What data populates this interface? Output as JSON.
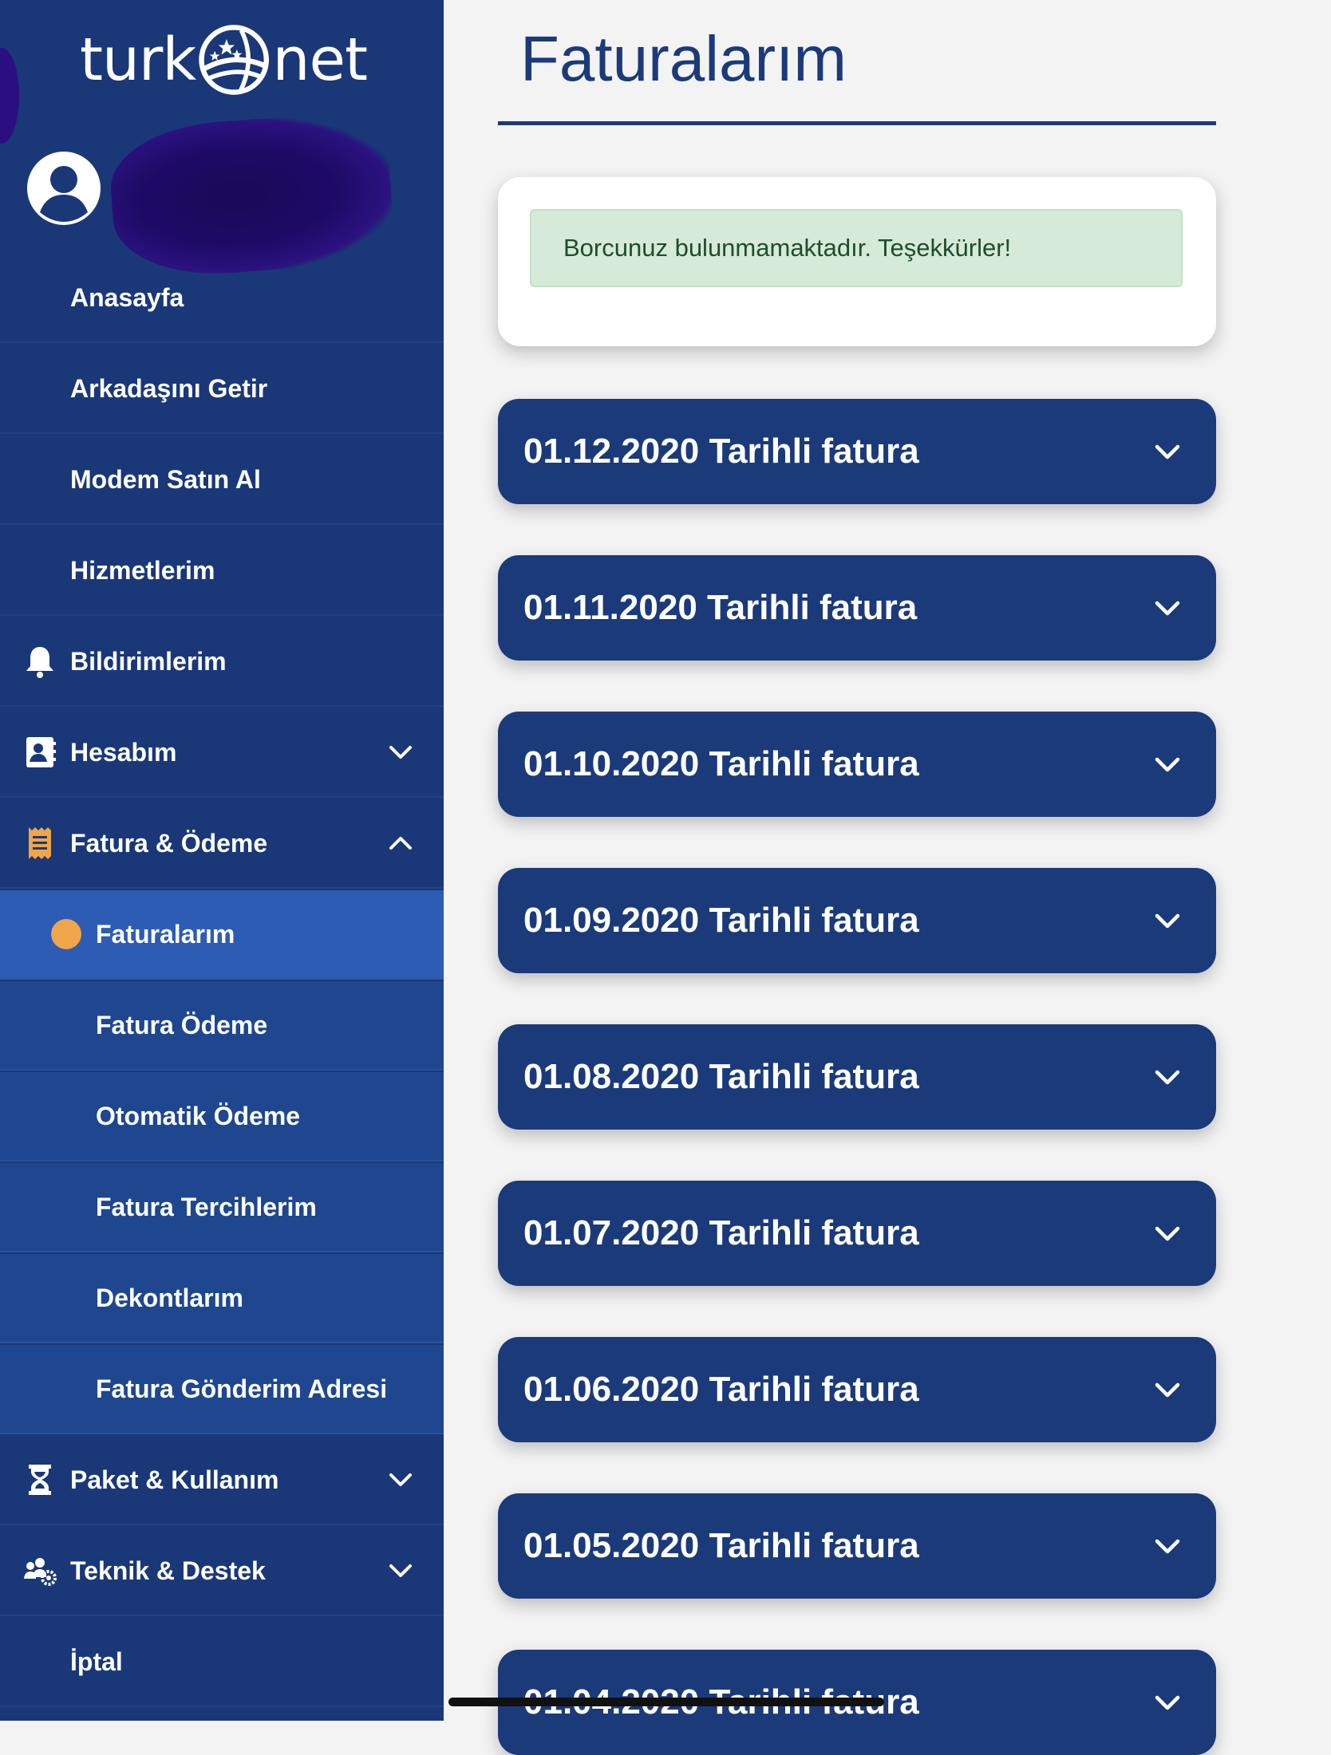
{
  "brand": {
    "logo_left": "turk",
    "logo_right": "net"
  },
  "sidebar": {
    "items": [
      {
        "label": "Anasayfa"
      },
      {
        "label": "Arkadaşını Getir"
      },
      {
        "label": "Modem Satın Al"
      },
      {
        "label": "Hizmetlerim"
      },
      {
        "label": "Bildirimlerim",
        "icon": "bell-icon"
      },
      {
        "label": "Hesabım",
        "icon": "contact-card-icon",
        "expanded": false
      },
      {
        "label": "Fatura & Ödeme",
        "icon": "receipt-icon",
        "expanded": true
      },
      {
        "label": "Paket & Kullanım",
        "icon": "hourglass-icon",
        "expanded": false
      },
      {
        "label": "Teknik & Destek",
        "icon": "users-gear-icon",
        "expanded": false
      },
      {
        "label": "İptal"
      }
    ],
    "submenu": [
      {
        "label": "Faturalarım",
        "active": true
      },
      {
        "label": "Fatura Ödeme"
      },
      {
        "label": "Otomatik Ödeme"
      },
      {
        "label": "Fatura Tercihlerim"
      },
      {
        "label": "Dekontlarım"
      },
      {
        "label": "Fatura Gönderim Adresi"
      }
    ]
  },
  "main": {
    "title": "Faturalarım",
    "alert": "Borcunuz bulunmamaktadır. Teşekkürler!",
    "invoices": [
      "01.12.2020 Tarihli fatura",
      "01.11.2020 Tarihli fatura",
      "01.10.2020 Tarihli fatura",
      "01.09.2020 Tarihli fatura",
      "01.08.2020 Tarihli fatura",
      "01.07.2020 Tarihli fatura",
      "01.06.2020 Tarihli fatura",
      "01.05.2020 Tarihli fatura",
      "01.04.2020 Tarihli fatura"
    ]
  },
  "colors": {
    "sidebar_bg": "#1a3878",
    "submenu_bg": "#1e4790",
    "active_bg": "#2c5cb4",
    "accent": "#f0a54a",
    "primary": "#1b3a7a",
    "alert_bg": "#d6ead9"
  }
}
